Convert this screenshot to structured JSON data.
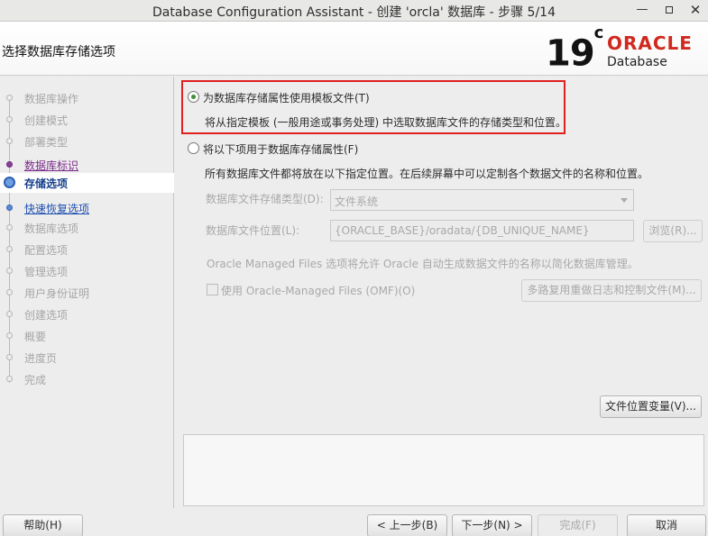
{
  "window": {
    "title": "Database Configuration Assistant - 创建 'orcla' 数据库 - 步骤 5/14",
    "minimize": "—",
    "close": "✕"
  },
  "header": {
    "page_title": "选择数据库存储选项",
    "logo_version": "19",
    "logo_version_sup": "c",
    "logo_brand": "ORACLE",
    "logo_product": "Database"
  },
  "sidebar": {
    "steps": [
      {
        "label": "数据库操作",
        "state": "disabled"
      },
      {
        "label": "创建模式",
        "state": "disabled"
      },
      {
        "label": "部署类型",
        "state": "disabled"
      },
      {
        "label": "数据库标识",
        "state": "visited"
      },
      {
        "label": "存储选项",
        "state": "current"
      },
      {
        "label": "快速恢复选项",
        "state": "link"
      },
      {
        "label": "数据库选项",
        "state": "disabled"
      },
      {
        "label": "配置选项",
        "state": "disabled"
      },
      {
        "label": "管理选项",
        "state": "disabled"
      },
      {
        "label": "用户身份证明",
        "state": "disabled"
      },
      {
        "label": "创建选项",
        "state": "disabled"
      },
      {
        "label": "概要",
        "state": "disabled"
      },
      {
        "label": "进度页",
        "state": "disabled"
      },
      {
        "label": "完成",
        "state": "disabled"
      }
    ]
  },
  "main": {
    "option_template_label": "为数据库存储属性使用模板文件(T)",
    "option_template_desc": "将从指定模板 (一般用途或事务处理) 中选取数据库文件的存储类型和位置。",
    "option_custom_label": "将以下项用于数据库存储属性(F)",
    "option_custom_desc": "所有数据库文件都将放在以下指定位置。在后续屏幕中可以定制各个数据文件的名称和位置。",
    "storage_type_label": "数据库文件存储类型(D):",
    "storage_type_value": "文件系统",
    "file_location_label": "数据库文件位置(L):",
    "file_location_value": "{ORACLE_BASE}/oradata/{DB_UNIQUE_NAME}",
    "browse_button": "浏览(R)...",
    "omf_desc": "Oracle Managed Files 选项将允许 Oracle 自动生成数据文件的名称以简化数据库管理。",
    "omf_checkbox_label": "使用 Oracle-Managed Files (OMF)(O)",
    "multiplex_button": "多路复用重做日志和控制文件(M)...",
    "file_vars_button": "文件位置变量(V)..."
  },
  "footer": {
    "help": "帮助(H)",
    "back": "< 上一步(B)",
    "next": "下一步(N) >",
    "finish": "完成(F)",
    "cancel": "取消"
  }
}
